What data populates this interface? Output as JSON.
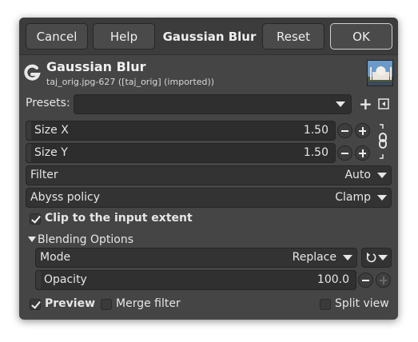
{
  "header": {
    "cancel_label": "Cancel",
    "help_label": "Help",
    "title": "Gaussian Blur",
    "reset_label": "Reset",
    "ok_label": "OK"
  },
  "info": {
    "operation_name": "Gaussian Blur",
    "image_label": "taj_orig.jpg-627 ([taj_orig] (imported))"
  },
  "presets": {
    "label": "Presets:",
    "value": ""
  },
  "size_x": {
    "label": "Size X",
    "value": "1.50"
  },
  "size_y": {
    "label": "Size Y",
    "value": "1.50"
  },
  "filter": {
    "label": "Filter",
    "value": "Auto"
  },
  "abyss_policy": {
    "label": "Abyss policy",
    "value": "Clamp"
  },
  "clip_extent": {
    "label": "Clip to the input extent",
    "checked": true
  },
  "blending": {
    "section_label": "Blending Options",
    "mode_label": "Mode",
    "mode_value": "Replace",
    "opacity_label": "Opacity",
    "opacity_value": "100.0"
  },
  "footer": {
    "preview_label": "Preview",
    "preview_checked": true,
    "merge_label": "Merge filter",
    "merge_checked": false,
    "split_label": "Split view",
    "split_checked": false
  },
  "colors": {
    "window_bg": "#454545",
    "field_bg": "#2d2d2d",
    "text": "#e6e6e6"
  }
}
